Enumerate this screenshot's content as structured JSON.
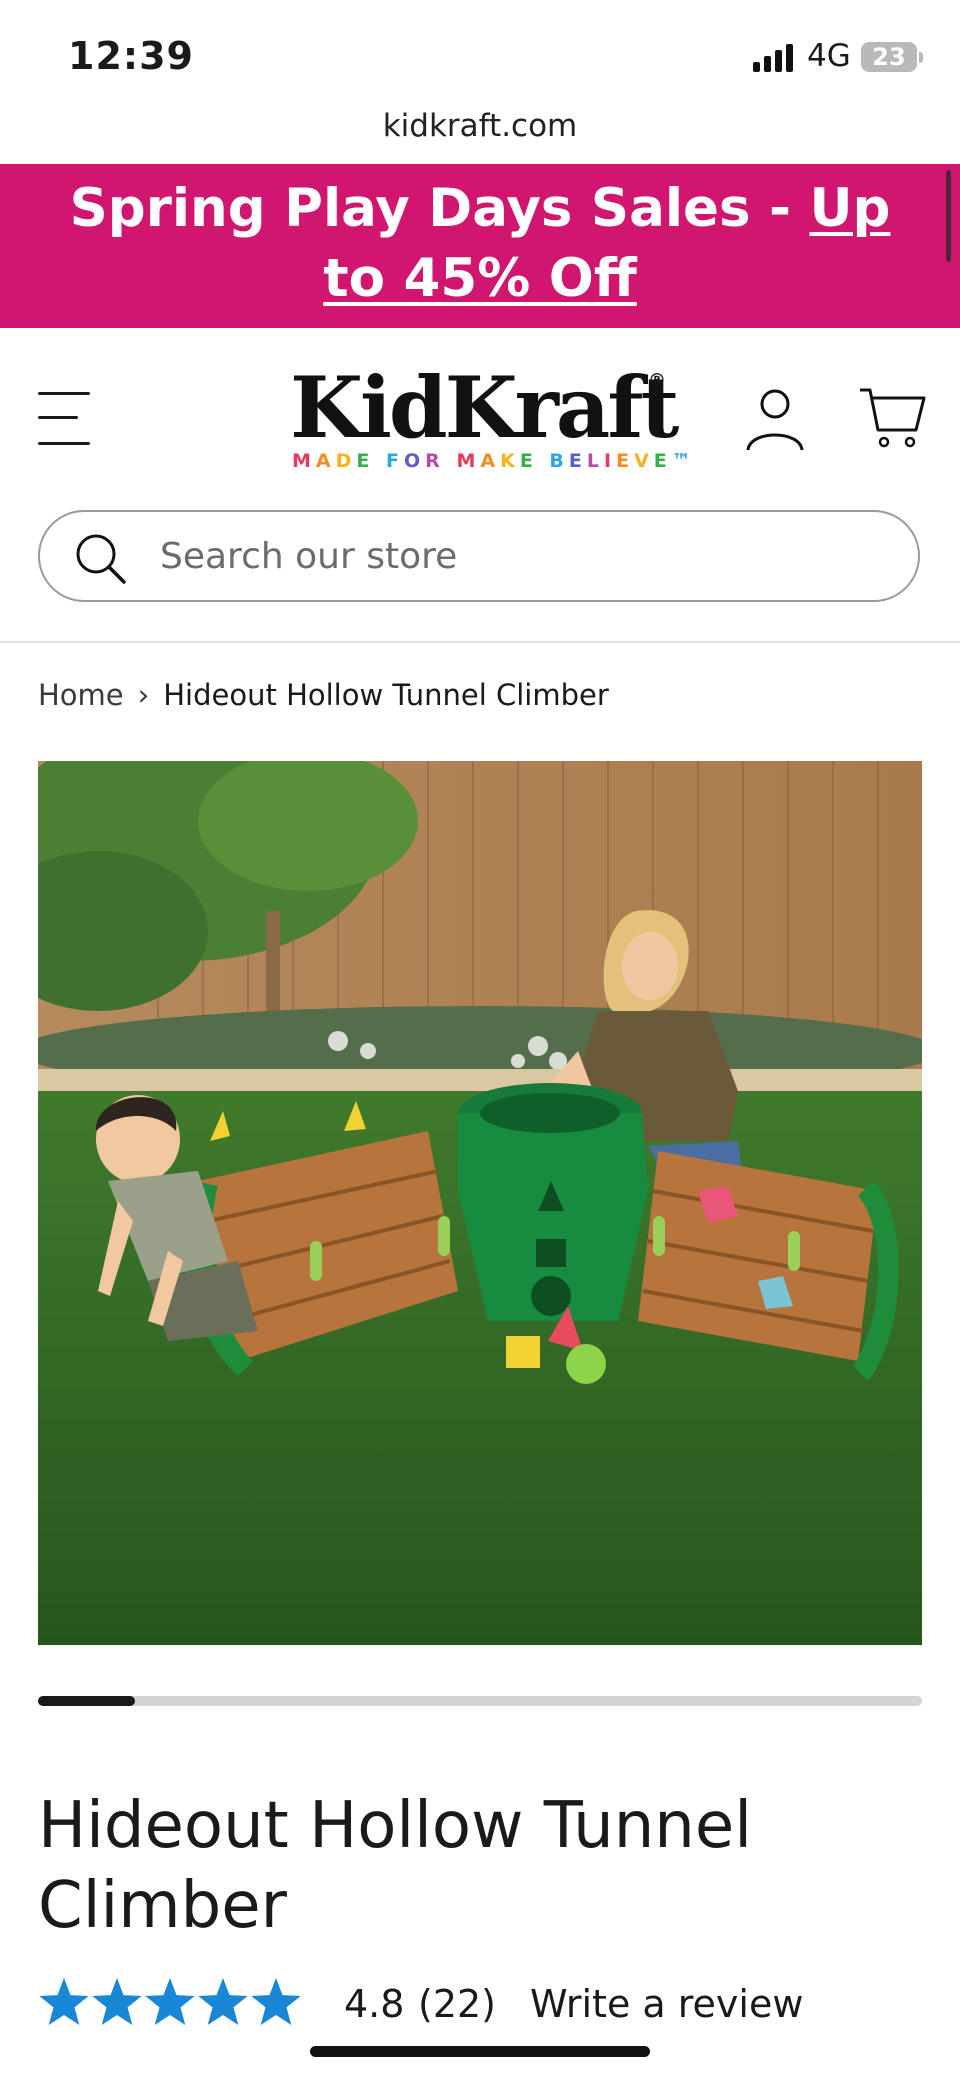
{
  "status_bar": {
    "time": "12:39",
    "network": "4G",
    "battery": "23"
  },
  "browser": {
    "url": "kidkraft.com"
  },
  "promo": {
    "text": "Spring Play Days Sales - ",
    "link": "Up to 45% Off"
  },
  "header": {
    "brand": "KidKraft",
    "registered": "®",
    "tagline_letters": [
      "M",
      "A",
      "D",
      "E",
      " ",
      "F",
      "O",
      "R",
      " ",
      "M",
      "A",
      "K",
      "E",
      " ",
      "B",
      "E",
      "L",
      "I",
      "E",
      "V",
      "E",
      "™"
    ],
    "tagline_colors": [
      "#e63a5c",
      "#f48c1f",
      "#f7b21a",
      "#33b04a",
      "#29a8e0",
      "#5b5fc7",
      "#b74aa6"
    ]
  },
  "search": {
    "placeholder": "Search our store"
  },
  "breadcrumb": {
    "home": "Home",
    "separator": "›",
    "current": "Hideout Hollow Tunnel Climber"
  },
  "gallery": {
    "position": 1,
    "progress": 0.11
  },
  "product": {
    "title": "Hideout Hollow Tunnel Climber",
    "rating": "4.8",
    "review_count": "(22)",
    "write_review": "Write a review",
    "star_color": "#1a86d6"
  }
}
